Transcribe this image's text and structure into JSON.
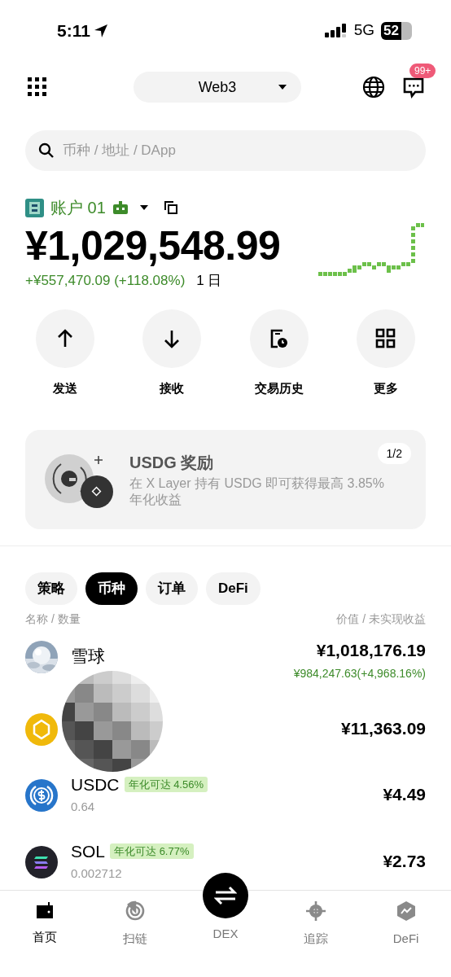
{
  "status_bar": {
    "time": "5:11",
    "network": "5G",
    "battery": "52"
  },
  "header": {
    "network_selector": "Web3",
    "notification_badge": "99+"
  },
  "search": {
    "placeholder": "币种 / 地址 / DApp"
  },
  "account": {
    "name": "账户 01",
    "balance": "¥1,029,548.99",
    "change": "+¥557,470.09 (+118.08%)",
    "period": "1 日"
  },
  "actions": [
    {
      "label": "发送"
    },
    {
      "label": "接收"
    },
    {
      "label": "交易历史"
    },
    {
      "label": "更多"
    }
  ],
  "banner": {
    "title": "USDG 奖励",
    "text": "在 X Layer 持有 USDG 即可获得最高 3.85% 年化收益",
    "pager": "1/2"
  },
  "tabs": [
    {
      "label": "策略",
      "selected": false
    },
    {
      "label": "币种",
      "selected": true
    },
    {
      "label": "订单",
      "selected": false
    },
    {
      "label": "DeFi",
      "selected": false
    }
  ],
  "list_header": {
    "left": "名称 / 数量",
    "right": "价值 / 未实现收益"
  },
  "assets": [
    {
      "name": "雪球",
      "value": "¥1,018,176.19",
      "pnl": "¥984,247.63(+4,968.16%)"
    },
    {
      "value": "¥11,363.09"
    },
    {
      "name": "USDC",
      "tag": "年化可达 4.56%",
      "quantity": "0.64",
      "value": "¥4.49"
    },
    {
      "name": "SOL",
      "tag": "年化可达 6.77%",
      "quantity": "0.002712",
      "value": "¥2.73"
    }
  ],
  "bottom_nav": [
    {
      "label": "首页",
      "selected": true
    },
    {
      "label": "扫链",
      "selected": false
    },
    {
      "label": "DEX",
      "selected": false
    },
    {
      "label": "追踪",
      "selected": false
    },
    {
      "label": "DeFi",
      "selected": false
    }
  ]
}
